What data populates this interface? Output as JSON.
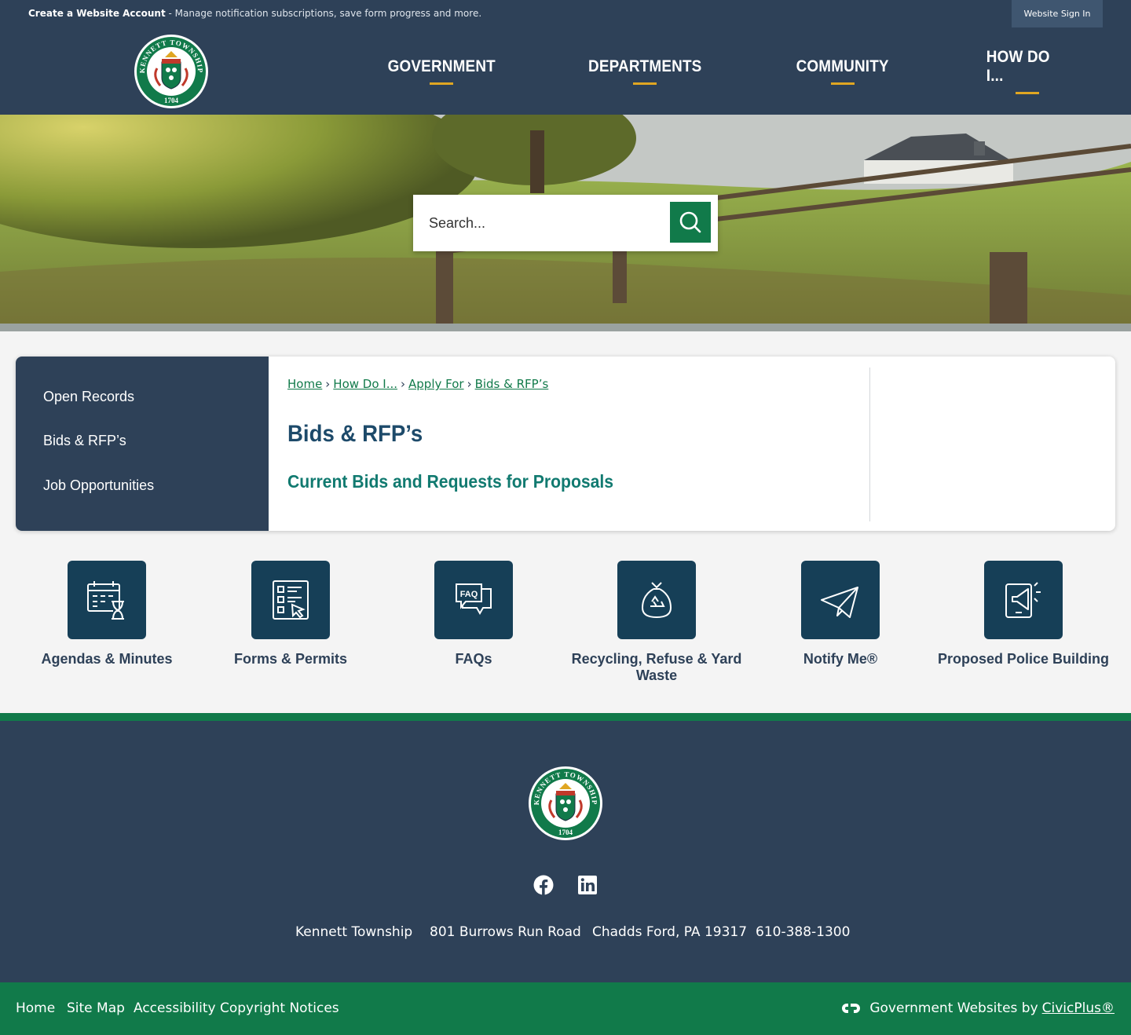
{
  "topbar": {
    "account_link": "Create a Website Account",
    "account_message": " - Manage notification subscriptions, save form progress and more.",
    "sign_in": "Website Sign In"
  },
  "header": {
    "logo_text": "KENNETT TOWNSHIP",
    "logo_year": "1704",
    "nav": [
      "GOVERNMENT",
      "DEPARTMENTS",
      "COMMUNITY",
      "HOW DO I..."
    ]
  },
  "search": {
    "placeholder": "Search..."
  },
  "sidebar": {
    "items": [
      "Open Records",
      "Bids & RFP’s",
      "Job Opportunities"
    ]
  },
  "breadcrumb": [
    "Home",
    "How Do I...",
    "Apply For",
    "Bids & RFP’s"
  ],
  "main": {
    "title": "Bids & RFP’s",
    "subheading": "Current Bids and Requests for Proposals"
  },
  "quick_links": [
    {
      "label": "Agendas & Minutes",
      "icon": "calendar-hourglass-icon"
    },
    {
      "label": "Forms & Permits",
      "icon": "form-checklist-icon"
    },
    {
      "label": "FAQs",
      "icon": "faq-bubble-icon"
    },
    {
      "label": "Recycling, Refuse & Yard Waste",
      "icon": "recycle-bag-icon"
    },
    {
      "label": "Notify Me®",
      "icon": "paper-plane-icon"
    },
    {
      "label": "Proposed Police Building",
      "icon": "tablet-megaphone-icon"
    }
  ],
  "footer": {
    "social": [
      "facebook-icon",
      "linkedin-icon"
    ],
    "address": [
      "Kennett Township",
      "801 Burrows Run Road",
      "Chadds Ford, PA 19317",
      "610-388-1300"
    ],
    "links": [
      "Home",
      "Site Map",
      "Accessibility",
      "Copyright Notices"
    ],
    "credit_prefix": "Government Websites by",
    "credit_link": "CivicPlus®"
  },
  "colors": {
    "navy": "#2e4158",
    "green": "#117a4a",
    "tile": "#163f57",
    "accent": "#e0a622",
    "title": "#1d4a6a",
    "subheading": "#117a70"
  }
}
